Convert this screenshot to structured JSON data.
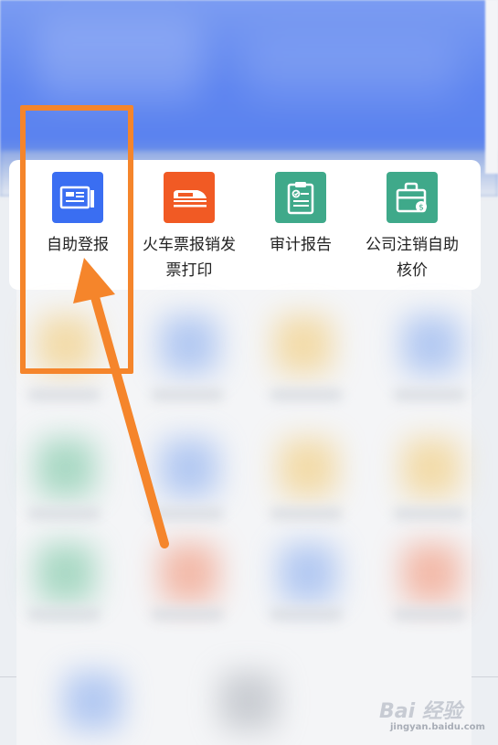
{
  "services": [
    {
      "label": "自助登报",
      "icon": "newspaper-icon",
      "color": "#3a6ef2"
    },
    {
      "label": "火车票报销发票打印",
      "icon": "train-icon",
      "color": "#f15a24"
    },
    {
      "label": "审计报告",
      "icon": "clipboard-check-icon",
      "color": "#3fa98a"
    },
    {
      "label": "公司注销自助核价",
      "icon": "briefcase-icon",
      "color": "#3fa98a"
    }
  ],
  "annotation": {
    "color": "#f5852b"
  },
  "watermark": {
    "brand": "Bai 经验",
    "url": "jingyan.baidu.com"
  }
}
